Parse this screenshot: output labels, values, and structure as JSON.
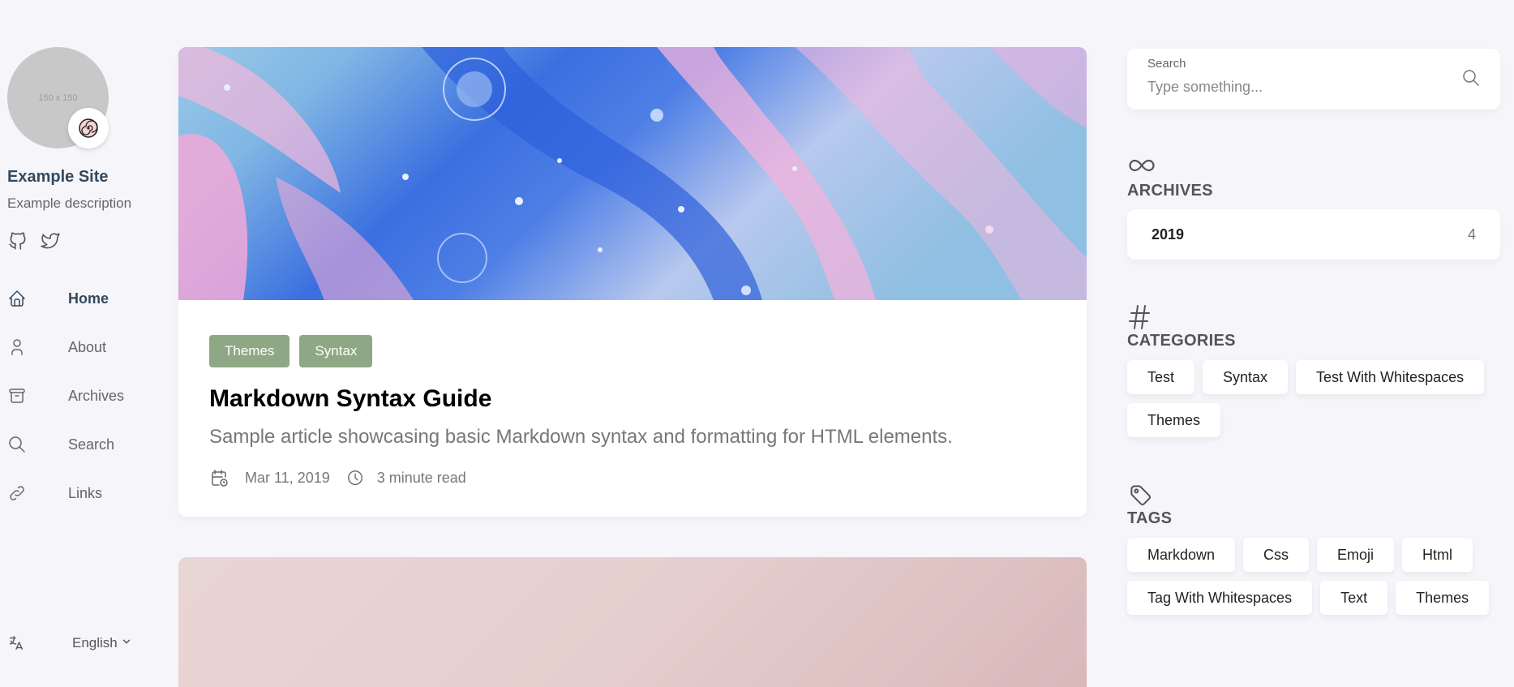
{
  "site": {
    "avatar_placeholder": "150 x 150",
    "name": "Example Site",
    "description": "Example description"
  },
  "social": [
    {
      "icon": "github-icon"
    },
    {
      "icon": "twitter-icon"
    }
  ],
  "menu": [
    {
      "label": "Home",
      "icon": "home-icon",
      "active": true
    },
    {
      "label": "About",
      "icon": "user-icon"
    },
    {
      "label": "Archives",
      "icon": "archive-icon"
    },
    {
      "label": "Search",
      "icon": "search-icon"
    },
    {
      "label": "Links",
      "icon": "link-icon"
    }
  ],
  "language": {
    "label": "English"
  },
  "article": {
    "categories": [
      "Themes",
      "Syntax"
    ],
    "title": "Markdown Syntax Guide",
    "subtitle": "Sample article showcasing basic Markdown syntax and formatting for HTML elements.",
    "date": "Mar 11, 2019",
    "read_time": "3 minute read"
  },
  "search": {
    "label": "Search",
    "placeholder": "Type something..."
  },
  "archives": {
    "title": "ARCHIVES",
    "items": [
      {
        "year": "2019",
        "count": "4"
      }
    ]
  },
  "categories": {
    "title": "CATEGORIES",
    "items": [
      "Test",
      "Syntax",
      "Test With Whitespaces",
      "Themes"
    ]
  },
  "tags": {
    "title": "TAGS",
    "items": [
      "Markdown",
      "Css",
      "Emoji",
      "Html",
      "Tag With Whitespaces",
      "Text",
      "Themes"
    ]
  },
  "colors": {
    "background": "#f5f5fa",
    "accent_badge": "#8ea885",
    "title_active": "#34495e"
  }
}
